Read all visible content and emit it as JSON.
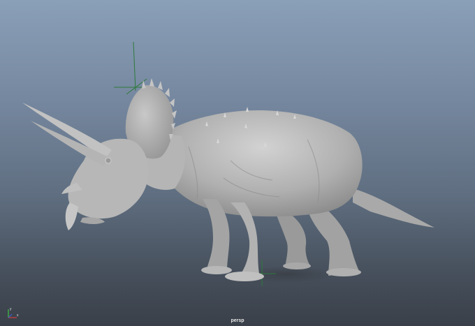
{
  "viewport": {
    "camera_name": "persp",
    "background_top": "#8aa0b8",
    "background_bottom": "#3a4049"
  },
  "axis_gizmo": {
    "x_label": "x",
    "y_label": "y",
    "x_color": "#d04040",
    "y_color": "#40c040"
  },
  "model": {
    "icon": "triceratops-model",
    "color": "#b8b8b8"
  }
}
